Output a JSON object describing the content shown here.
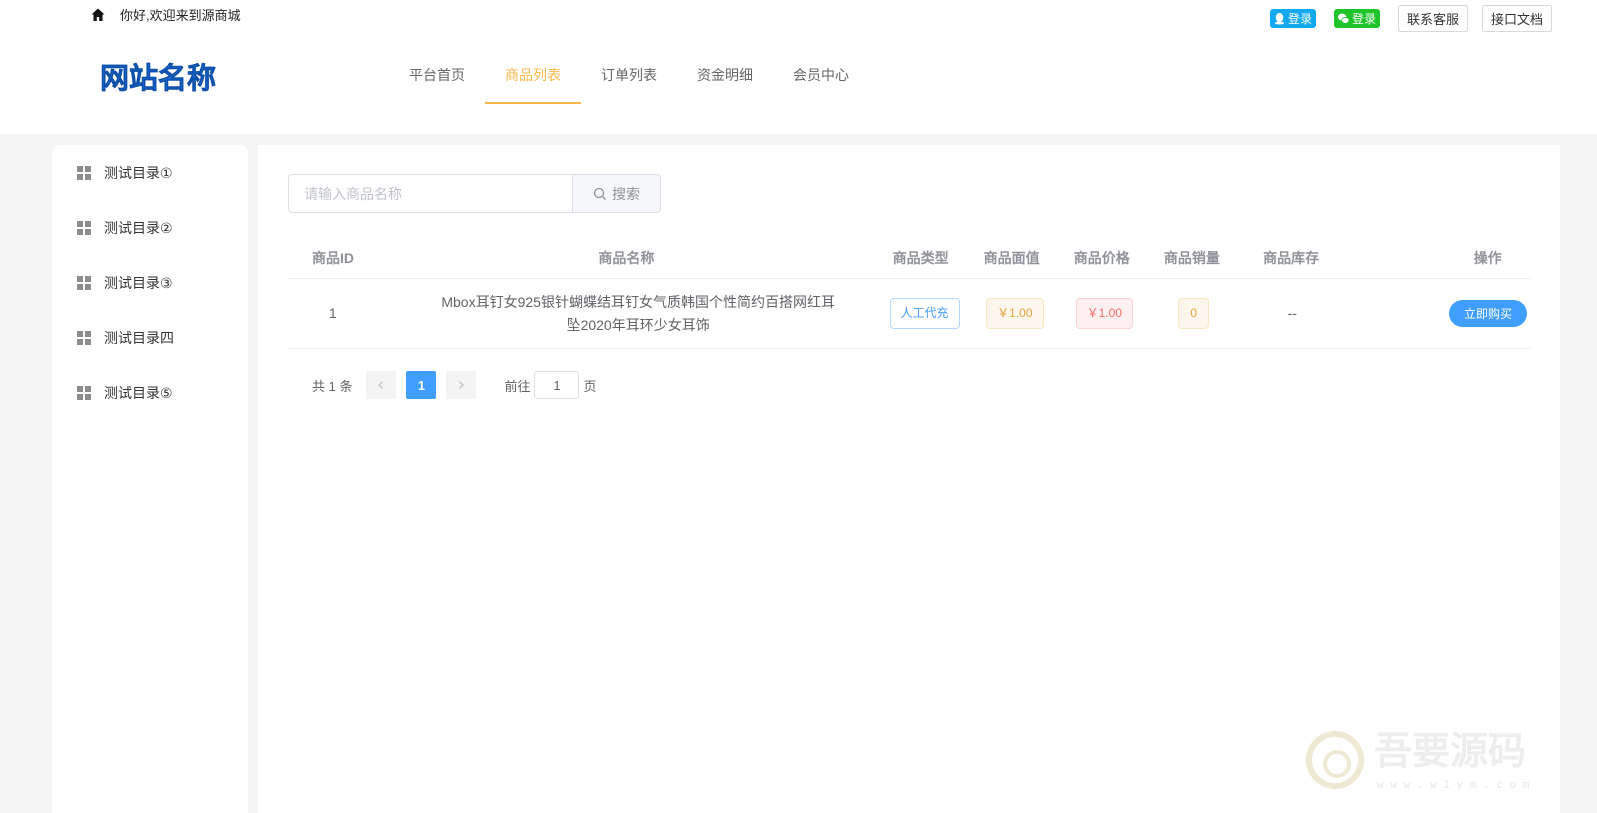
{
  "topbar": {
    "welcome": "你好,欢迎来到源商城",
    "qq_login": "登录",
    "wechat_login": "登录",
    "contact": "联系客服",
    "api_docs": "接口文档"
  },
  "logo": {
    "text": "网站名称",
    "color": "#1e6fdc"
  },
  "nav": {
    "items": [
      {
        "label": "平台首页"
      },
      {
        "label": "商品列表"
      },
      {
        "label": "订单列表"
      },
      {
        "label": "资金明细"
      },
      {
        "label": "会员中心"
      }
    ],
    "active": "商品列表",
    "accent": "#f7b84a"
  },
  "sidebar": {
    "items": [
      {
        "label": "测试目录①"
      },
      {
        "label": "测试目录②"
      },
      {
        "label": "测试目录③"
      },
      {
        "label": "测试目录四"
      },
      {
        "label": "测试目录⑤"
      }
    ]
  },
  "search": {
    "placeholder": "请输入商品名称",
    "button": "搜索"
  },
  "table": {
    "headers": {
      "id": "商品ID",
      "name": "商品名称",
      "type": "商品类型",
      "face": "商品面值",
      "price": "商品价格",
      "sales": "商品销量",
      "stock": "商品库存",
      "op": "操作"
    },
    "rows": [
      {
        "id": "1",
        "name": "Mbox耳钉女925银针蝴蝶结耳钉女气质韩国个性简约百搭网红耳坠2020年耳环少女耳饰",
        "type": "人工代充",
        "face": "￥1.00",
        "price": "￥1.00",
        "sales": "0",
        "stock": "--",
        "op": "立即购买"
      }
    ]
  },
  "pagination": {
    "total": "共 1 条",
    "current": "1",
    "goto_label": "前往",
    "goto_value": "1",
    "page_suffix": "页"
  },
  "watermark": {
    "title": "吾要源码",
    "url": "w w w . w 1 y m . c o m"
  },
  "colors": {
    "primary": "#409eff",
    "qq": "#12a9f0",
    "wechat": "#1ec42a"
  }
}
